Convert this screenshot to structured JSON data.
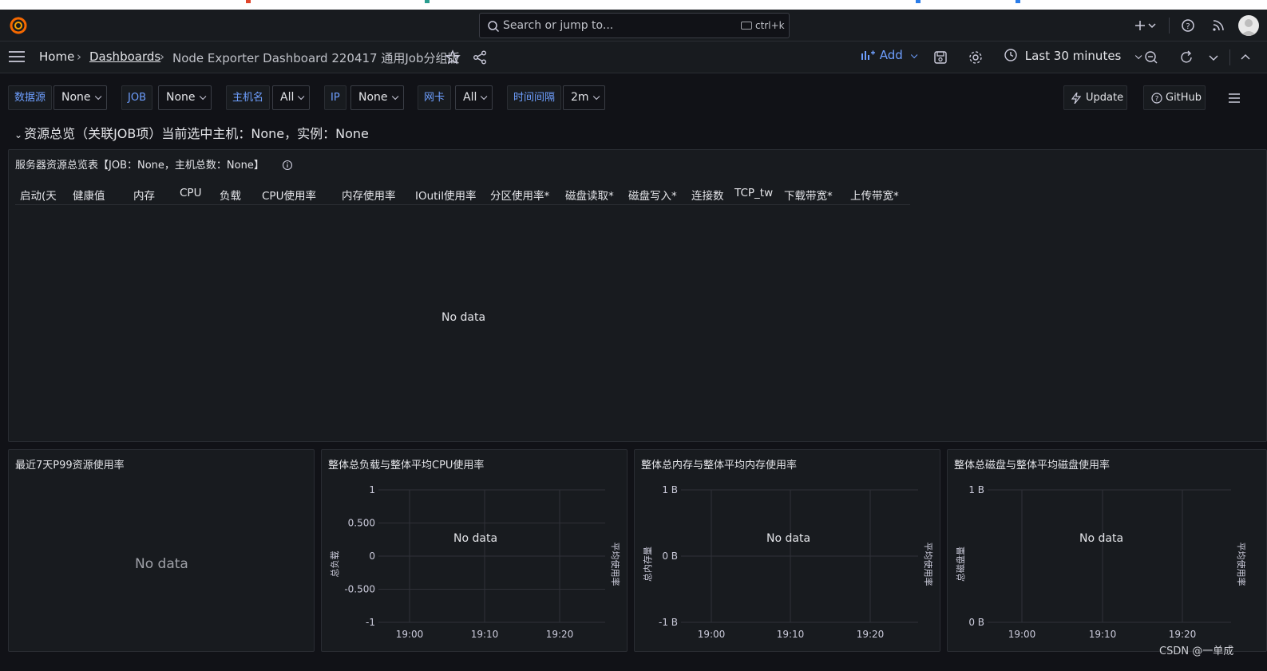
{
  "topbar": {
    "search_placeholder": "Search or jump to...",
    "shortcut": "ctrl+k"
  },
  "breadcrumb": {
    "home": "Home",
    "dashboards": "Dashboards",
    "current": "Node Exporter Dashboard 220417 通用Job分组版"
  },
  "toolbar": {
    "add_label": "Add",
    "time_range": "Last 30 minutes"
  },
  "variables": [
    {
      "label": "数据源",
      "value": "None"
    },
    {
      "label": "JOB",
      "value": "None"
    },
    {
      "label": "主机名",
      "value": "All"
    },
    {
      "label": "IP",
      "value": "None"
    },
    {
      "label": "网卡",
      "value": "All"
    },
    {
      "label": "时间间隔",
      "value": "2m"
    }
  ],
  "links": {
    "update": "Update",
    "github": "GitHub"
  },
  "row": {
    "title": "资源总览（关联JOB项）当前选中主机：None，实例：None"
  },
  "table_panel": {
    "title": "服务器资源总览表【JOB：None，主机总数：None】",
    "columns": [
      "启动(天",
      "健康值",
      "内存",
      "CPU",
      "负载",
      "CPU使用率",
      "内存使用率",
      "IOutil使用率",
      "分区使用率*",
      "磁盘读取*",
      "磁盘写入*",
      "连接数",
      "TCP_tw",
      "下载带宽*",
      "上传带宽*"
    ],
    "no_data": "No data"
  },
  "p99_panel": {
    "title": "最近7天P99资源使用率",
    "no_data": "No data"
  },
  "load_panel": {
    "title": "整体总负载与整体平均CPU使用率",
    "no_data": "No data"
  },
  "mem_panel": {
    "title": "整体总内存与整体平均内存使用率",
    "no_data": "No data"
  },
  "disk_panel": {
    "title": "整体总磁盘与整体平均磁盘使用率",
    "no_data": "No data"
  },
  "chart_data": [
    {
      "type": "line",
      "title": "整体总负载与整体平均CPU使用率",
      "ylabel": "总负载",
      "ylabel_right": "平均使用率",
      "yticks": [
        "1",
        "0.500",
        "0",
        "-0.500",
        "-1"
      ],
      "ylim": [
        -1,
        1
      ],
      "xticks": [
        "19:00",
        "19:10",
        "19:20"
      ],
      "series": [],
      "grid": true
    },
    {
      "type": "line",
      "title": "整体总内存与整体平均内存使用率",
      "ylabel": "总内存量",
      "ylabel_right": "平均使用率",
      "yticks": [
        "1 B",
        "0 B",
        "-1 B"
      ],
      "xticks": [
        "19:00",
        "19:10",
        "19:20"
      ],
      "series": [],
      "grid": true
    },
    {
      "type": "line",
      "title": "整体总磁盘与整体平均磁盘使用率",
      "ylabel": "总磁盘量",
      "ylabel_right": "平均使用率",
      "yticks": [
        "1 B",
        "0 B"
      ],
      "xticks": [
        "19:00",
        "19:10",
        "19:20"
      ],
      "series": [],
      "grid": true
    }
  ],
  "watermark": "CSDN @一单成"
}
